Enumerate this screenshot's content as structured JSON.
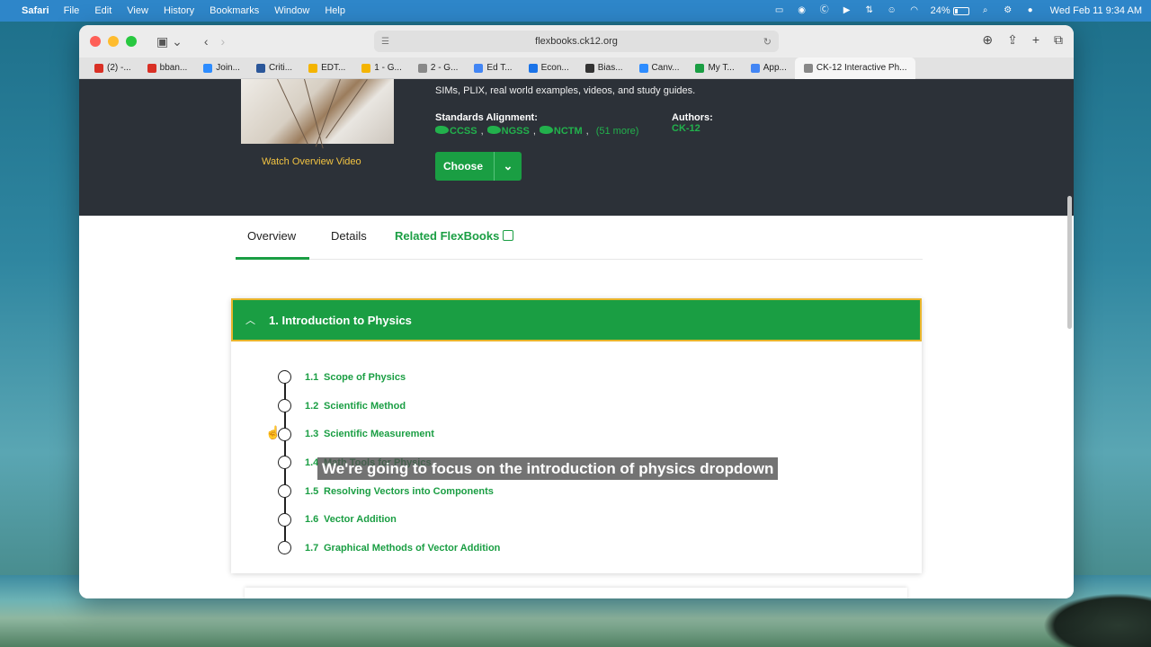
{
  "menubar": {
    "app": "Safari",
    "menus": [
      "File",
      "Edit",
      "View",
      "History",
      "Bookmarks",
      "Window",
      "Help"
    ],
    "battery": "24%",
    "battery_level": 0.24,
    "clock": "Wed Feb 11  9:34 AM"
  },
  "browser": {
    "url": "flexbooks.ck12.org",
    "tabs": [
      {
        "label": "(2) -...",
        "color": "#d93025"
      },
      {
        "label": "bban...",
        "color": "#d93025"
      },
      {
        "label": "Join...",
        "color": "#2d8cff"
      },
      {
        "label": "Criti...",
        "color": "#2b579a"
      },
      {
        "label": "EDT...",
        "color": "#f4b400"
      },
      {
        "label": "1 - G...",
        "color": "#f4b400"
      },
      {
        "label": "2 - G...",
        "color": "#888888"
      },
      {
        "label": "Ed T...",
        "color": "#4285f4"
      },
      {
        "label": "Econ...",
        "color": "#1a73e8"
      },
      {
        "label": "Bias...",
        "color": "#333333"
      },
      {
        "label": "Canv...",
        "color": "#2d8cff"
      },
      {
        "label": "My T...",
        "color": "#1a9e43"
      },
      {
        "label": "App...",
        "color": "#4285f4"
      },
      {
        "label": "CK-12 Interactive Ph...",
        "color": "#888888"
      }
    ]
  },
  "hero": {
    "sims_text": "SIMs, PLIX, real world examples, videos, and study guides.",
    "watch_video": "Watch Overview Video",
    "standards_label": "Standards Alignment:",
    "standards": [
      "CCSS",
      "NGSS",
      "NCTM"
    ],
    "standards_more": "(51 more)",
    "authors_label": "Authors:",
    "authors_value": "CK-12",
    "choose_label": "Choose"
  },
  "nav_tabs": {
    "overview": "Overview",
    "details": "Details",
    "related": "Related FlexBooks"
  },
  "chapter": {
    "title": "1. Introduction to Physics",
    "lessons": [
      {
        "num": "1.1",
        "name": "Scope of Physics"
      },
      {
        "num": "1.2",
        "name": "Scientific Method"
      },
      {
        "num": "1.3",
        "name": "Scientific Measurement"
      },
      {
        "num": "1.4",
        "name": "Math Tools for Physics"
      },
      {
        "num": "1.5",
        "name": "Resolving Vectors into Components"
      },
      {
        "num": "1.6",
        "name": "Vector Addition"
      },
      {
        "num": "1.7",
        "name": "Graphical Methods of Vector Addition"
      }
    ]
  },
  "caption": "We're going to focus on the introduction of physics dropdown",
  "colors": {
    "brand_green": "#1a9e43",
    "hero_dark": "#2c3138",
    "accent_yellow": "#f2c342"
  }
}
